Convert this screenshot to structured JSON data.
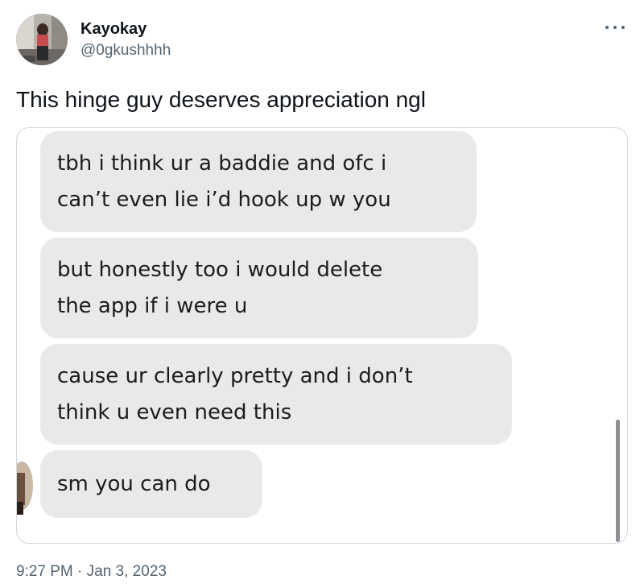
{
  "author": {
    "display_name": "Kayokay",
    "handle": "@0gkushhhh"
  },
  "tweet": {
    "text": "This hinge guy deserves appreciation ngl",
    "timestamp": "9:27 PM · Jan 3, 2023"
  },
  "icons": {
    "more": "more-options-icon",
    "avatar": "profile-avatar"
  },
  "media": {
    "messages": [
      {
        "line1": "tbh i think ur a baddie and ofc i",
        "line2": "can’t even lie i’d hook up w you"
      },
      {
        "line1": "but honestly too i would delete",
        "line2": "the app if i were u"
      },
      {
        "line1": "cause ur clearly pretty and i don’t",
        "line2": "think u even need this"
      },
      {
        "line1": "sm you can do"
      }
    ]
  },
  "colors": {
    "text_primary": "#0f1419",
    "text_secondary": "#536471",
    "bubble_bg": "#e9e9eb",
    "border": "#cfd9de"
  }
}
